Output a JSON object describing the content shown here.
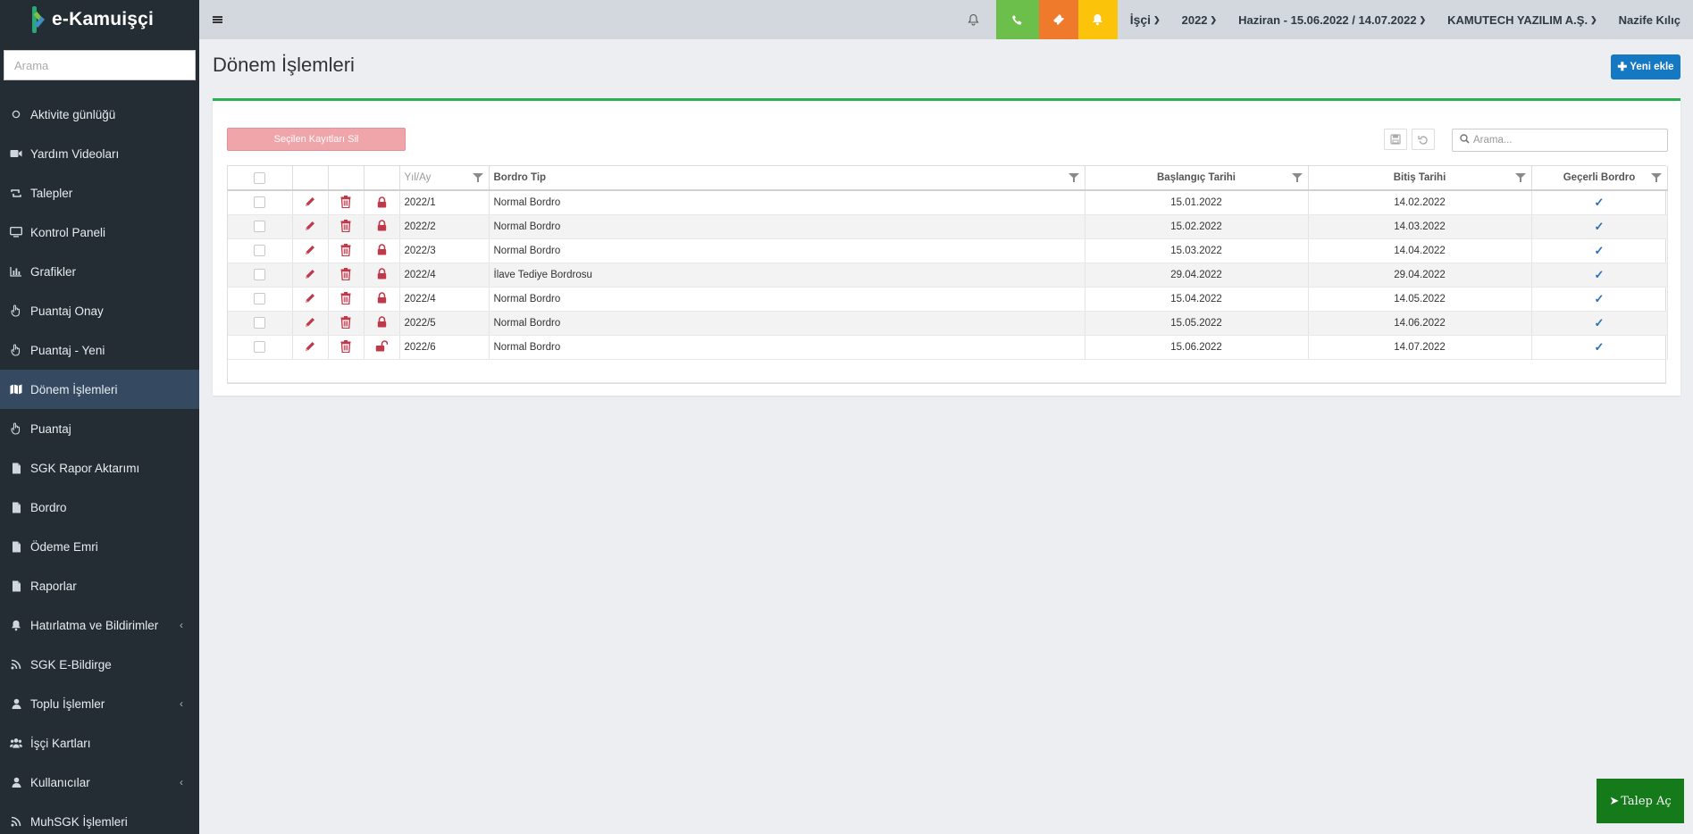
{
  "app": {
    "logo_text": "e-Kamuişçi"
  },
  "sidebar": {
    "search_placeholder": "Arama",
    "items": [
      {
        "label": "Aktivite günlüğü",
        "icon": "circle-icon"
      },
      {
        "label": "Yardım Videoları",
        "icon": "video-camera-icon"
      },
      {
        "label": "Talepler",
        "icon": "retweet-icon"
      },
      {
        "label": "Kontrol Paneli",
        "icon": "desktop-icon"
      },
      {
        "label": "Grafikler",
        "icon": "bar-chart-icon"
      },
      {
        "label": "Puantaj Onay",
        "icon": "hand-pointer-icon"
      },
      {
        "label": "Puantaj - Yeni",
        "icon": "hand-pointer-icon"
      },
      {
        "label": "Dönem İşlemleri",
        "icon": "map-icon",
        "active": true
      },
      {
        "label": "Puantaj",
        "icon": "hand-pointer-icon"
      },
      {
        "label": "SGK Rapor Aktarımı",
        "icon": "file-icon"
      },
      {
        "label": "Bordro",
        "icon": "file-icon"
      },
      {
        "label": "Ödeme Emri",
        "icon": "file-icon"
      },
      {
        "label": "Raporlar",
        "icon": "file-icon"
      },
      {
        "label": "Hatırlatma ve Bildirimler",
        "icon": "bell-icon",
        "chevron": true
      },
      {
        "label": "SGK E-Bildirge",
        "icon": "rss-icon"
      },
      {
        "label": "Toplu İşlemler",
        "icon": "user-icon",
        "chevron": true
      },
      {
        "label": "İşçi Kartları",
        "icon": "users-icon"
      },
      {
        "label": "Kullanıcılar",
        "icon": "user-icon",
        "chevron": true
      },
      {
        "label": "MuhSGK İşlemleri",
        "icon": "rss-icon"
      }
    ]
  },
  "topbar": {
    "role": "İşçi",
    "year": "2022",
    "period": "Haziran - 15.06.2022 / 14.07.2022",
    "company": "KAMUTECH YAZILIM A.Ş.",
    "user": "Nazife Kılıç",
    "colors": {
      "green": "#6cbf4b",
      "orange": "#ef7a2c",
      "yellow": "#fbc30a"
    }
  },
  "page": {
    "title": "Dönem İşlemleri",
    "new_button": "Yeni ekle",
    "delete_selected": "Seçilen Kayıtları Sil",
    "grid_search_placeholder": "Arama..."
  },
  "grid": {
    "columns": {
      "year_month": "Yıl/Ay",
      "bordro_tip": "Bordro Tip",
      "start": "Başlangıç Tarihi",
      "end": "Bitiş Tarihi",
      "valid": "Geçerli Bordro"
    },
    "rows": [
      {
        "year_month": "2022/1",
        "bordro_tip": "Normal Bordro",
        "start": "15.01.2022",
        "end": "14.02.2022",
        "locked": true,
        "valid": true
      },
      {
        "year_month": "2022/2",
        "bordro_tip": "Normal Bordro",
        "start": "15.02.2022",
        "end": "14.03.2022",
        "locked": true,
        "valid": true
      },
      {
        "year_month": "2022/3",
        "bordro_tip": "Normal Bordro",
        "start": "15.03.2022",
        "end": "14.04.2022",
        "locked": true,
        "valid": true
      },
      {
        "year_month": "2022/4",
        "bordro_tip": "İlave Tediye Bordrosu",
        "start": "29.04.2022",
        "end": "29.04.2022",
        "locked": true,
        "valid": true
      },
      {
        "year_month": "2022/4",
        "bordro_tip": "Normal Bordro",
        "start": "15.04.2022",
        "end": "14.05.2022",
        "locked": true,
        "valid": true
      },
      {
        "year_month": "2022/5",
        "bordro_tip": "Normal Bordro",
        "start": "15.05.2022",
        "end": "14.06.2022",
        "locked": true,
        "valid": true
      },
      {
        "year_month": "2022/6",
        "bordro_tip": "Normal Bordro",
        "start": "15.06.2022",
        "end": "14.07.2022",
        "locked": false,
        "valid": true
      }
    ]
  },
  "talep_button": "Talep Aç"
}
